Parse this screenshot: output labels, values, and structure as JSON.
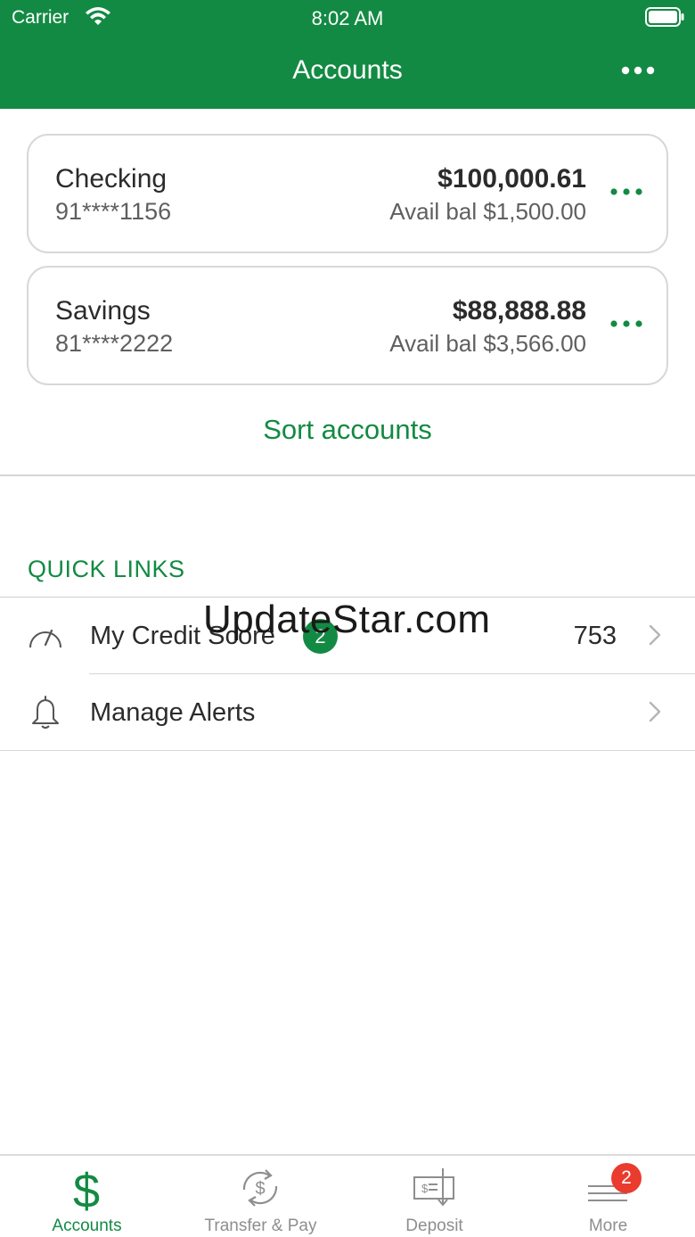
{
  "status_bar": {
    "carrier": "Carrier",
    "time": "8:02 AM"
  },
  "header": {
    "title": "Accounts"
  },
  "accounts": [
    {
      "name": "Checking",
      "number": "91****1156",
      "balance": "$100,000.61",
      "available": "Avail bal $1,500.00"
    },
    {
      "name": "Savings",
      "number": "81****2222",
      "balance": "$88,888.88",
      "available": "Avail bal $3,566.00"
    }
  ],
  "sort_link": "Sort accounts",
  "quick_links": {
    "heading": "QUICK LINKS",
    "items": [
      {
        "label": "My Credit Score",
        "badge": "2",
        "value": "753",
        "icon": "gauge-icon"
      },
      {
        "label": "Manage Alerts",
        "icon": "bell-icon"
      }
    ]
  },
  "watermark": "UpdateStar.com",
  "tabs": [
    {
      "label": "Accounts",
      "icon": "dollar-icon",
      "active": true
    },
    {
      "label": "Transfer & Pay",
      "icon": "transfer-icon"
    },
    {
      "label": "Deposit",
      "icon": "check-deposit-icon"
    },
    {
      "label": "More",
      "icon": "menu-icon",
      "badge": "2"
    }
  ],
  "colors": {
    "brand_green": "#138a43",
    "badge_red": "#ea3b2f",
    "border": "#d8d8d8"
  }
}
